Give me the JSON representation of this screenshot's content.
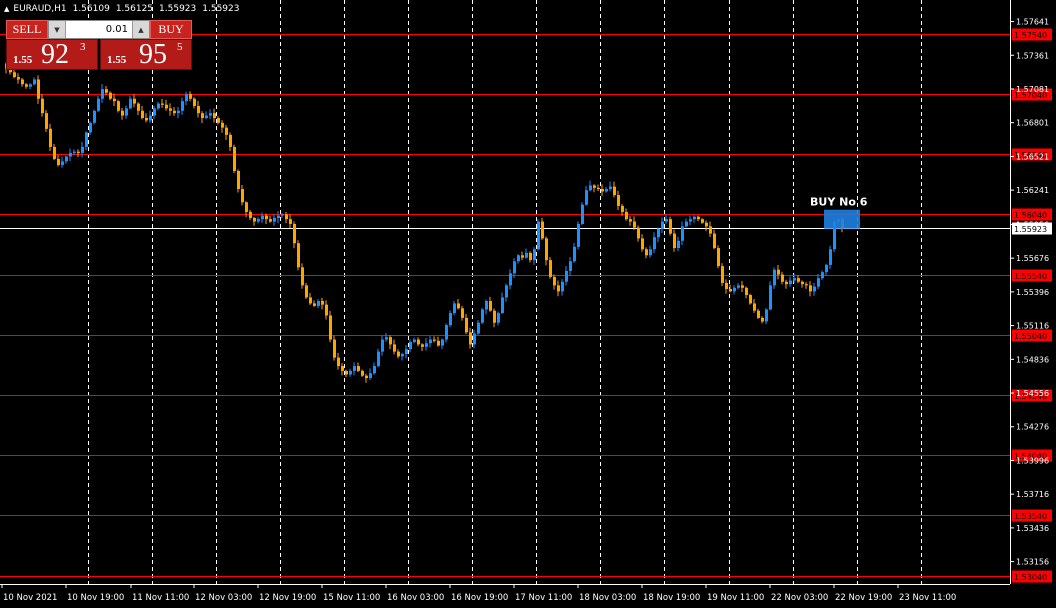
{
  "header": {
    "symbol": "EURAUD,H1",
    "open": "1.56109",
    "high": "1.56125",
    "low": "1.55923",
    "close": "1.55923"
  },
  "trade_panel": {
    "sell_label": "SELL",
    "buy_label": "BUY",
    "lot": "0.01",
    "bid_small": "1.55",
    "bid_big": "92",
    "bid_sup": "3",
    "ask_small": "1.55",
    "ask_big": "95",
    "ask_sup": "5"
  },
  "colors": {
    "background": "#000000",
    "bull": "#1e90ff",
    "bear": "#ffa500",
    "level_line": "#ff0000",
    "current_line": "#ffffff",
    "grid": "#ffffff"
  },
  "chart_data": {
    "type": "candlestick",
    "symbol": "EURAUD",
    "timeframe": "H1",
    "ylim": [
      1.5297,
      1.5782
    ],
    "y_ticks": [
      "1.57641",
      "1.57361",
      "1.57081",
      "1.56801",
      "1.56521",
      "1.56241",
      "1.55956",
      "1.55676",
      "1.55396",
      "1.55116",
      "1.54836",
      "1.54556",
      "1.54276",
      "1.53996",
      "1.53716",
      "1.53436",
      "1.53156"
    ],
    "x_labels": [
      "10 Nov 2021",
      "10 Nov 19:00",
      "11 Nov 11:00",
      "12 Nov 03:00",
      "12 Nov 19:00",
      "15 Nov 11:00",
      "16 Nov 03:00",
      "16 Nov 19:00",
      "17 Nov 11:00",
      "18 Nov 03:00",
      "18 Nov 19:00",
      "19 Nov 11:00",
      "22 Nov 03:00",
      "22 Nov 19:00",
      "23 Nov 11:00"
    ],
    "horizontal_levels": [
      "1.57540",
      "1.57040",
      "1.56540",
      "1.56040",
      "1.55540",
      "1.55040",
      "1.54540",
      "1.54040",
      "1.53540",
      "1.53040"
    ],
    "current_price": "1.55923",
    "annotation": {
      "text": "BUY No 6",
      "price": 1.5602
    },
    "closes": [
      1.5725,
      1.5722,
      1.5718,
      1.5716,
      1.5712,
      1.571,
      1.5712,
      1.5716,
      1.57,
      1.5688,
      1.5675,
      1.566,
      1.565,
      1.5645,
      1.5648,
      1.5652,
      1.5655,
      1.5656,
      1.5655,
      1.566,
      1.5672,
      1.568,
      1.569,
      1.57,
      1.5708,
      1.5705,
      1.57,
      1.5698,
      1.569,
      1.5686,
      1.5692,
      1.57,
      1.5696,
      1.569,
      1.5684,
      1.5682,
      1.5686,
      1.5692,
      1.5696,
      1.5695,
      1.5692,
      1.569,
      1.5688,
      1.569,
      1.5698,
      1.5704,
      1.57,
      1.5694,
      1.5688,
      1.5684,
      1.5686,
      1.5688,
      1.5684,
      1.568,
      1.5676,
      1.567,
      1.566,
      1.564,
      1.5625,
      1.5614,
      1.5606,
      1.5601,
      1.5598,
      1.56,
      1.5603,
      1.56,
      1.5598,
      1.5601,
      1.5603,
      1.5604,
      1.56,
      1.5596,
      1.558,
      1.556,
      1.5545,
      1.5535,
      1.553,
      1.5528,
      1.5532,
      1.5529,
      1.552,
      1.55,
      1.5485,
      1.5478,
      1.5474,
      1.5471,
      1.5474,
      1.5478,
      1.5474,
      1.547,
      1.5468,
      1.5472,
      1.5478,
      1.549,
      1.55,
      1.5502,
      1.5496,
      1.549,
      1.5486,
      1.5488,
      1.5492,
      1.5498,
      1.55,
      1.5496,
      1.5494,
      1.5497,
      1.55,
      1.5499,
      1.5495,
      1.55,
      1.5512,
      1.5522,
      1.553,
      1.5526,
      1.5518,
      1.5506,
      1.5496,
      1.5505,
      1.5514,
      1.5525,
      1.5532,
      1.5524,
      1.5514,
      1.5522,
      1.5535,
      1.5545,
      1.5555,
      1.5565,
      1.557,
      1.5568,
      1.5572,
      1.5566,
      1.5575,
      1.5598,
      1.5584,
      1.5566,
      1.5552,
      1.5545,
      1.554,
      1.5548,
      1.5557,
      1.5565,
      1.5577,
      1.5596,
      1.5612,
      1.5624,
      1.5628,
      1.5626,
      1.5625,
      1.5623,
      1.5625,
      1.5627,
      1.562,
      1.5611,
      1.5606,
      1.56,
      1.5598,
      1.5593,
      1.5584,
      1.5575,
      1.557,
      1.5575,
      1.5585,
      1.5592,
      1.5598,
      1.56,
      1.5588,
      1.5576,
      1.5582,
      1.5594,
      1.5598,
      1.56,
      1.5602,
      1.56,
      1.5597,
      1.5594,
      1.5588,
      1.5576,
      1.5561,
      1.5547,
      1.5542,
      1.554,
      1.5543,
      1.5545,
      1.5543,
      1.5537,
      1.553,
      1.5524,
      1.5518,
      1.5515,
      1.5525,
      1.5545,
      1.5558,
      1.5554,
      1.5548,
      1.5546,
      1.5549,
      1.5551,
      1.5548,
      1.5546,
      1.5545,
      1.554,
      1.5544,
      1.5551,
      1.5556,
      1.5562,
      1.5575,
      1.5598,
      1.56,
      1.5592
    ]
  }
}
